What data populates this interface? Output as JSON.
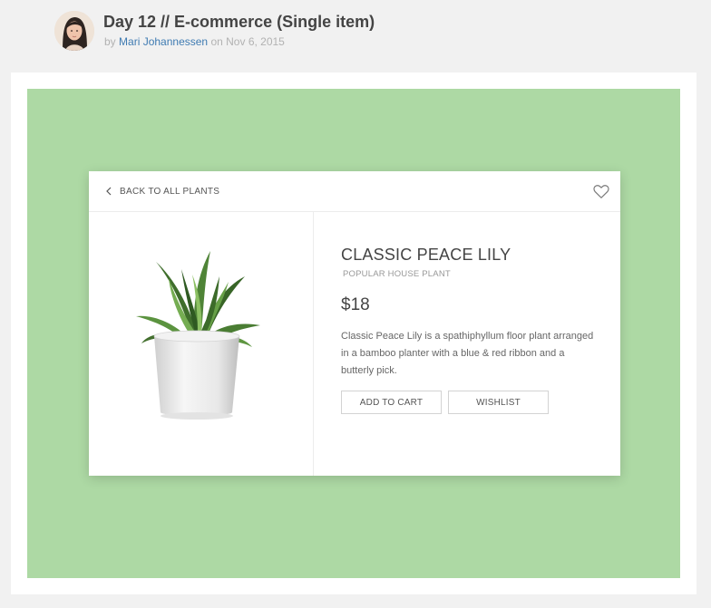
{
  "post": {
    "title": "Day 12 // E-commerce (Single item)",
    "by_prefix": "by",
    "author": "Mari Johannessen",
    "on_text": "on",
    "date": "Nov 6, 2015"
  },
  "product_card": {
    "back_label": "BACK TO ALL PLANTS",
    "name": "CLASSIC PEACE LILY",
    "subtitle": "POPULAR HOUSE PLANT",
    "price": "$18",
    "description": "Classic Peace Lily is a spathiphyllum floor plant arranged in a bamboo planter with a blue & red ribbon and a butterly pick.",
    "add_to_cart_label": "ADD TO CART",
    "wishlist_label": "WISHLIST"
  },
  "colors": {
    "shot_background": "#add9a4",
    "author_link": "#3f7bb2",
    "page_background": "#f1f1f1"
  },
  "icons": [
    "avatar",
    "chevron-left-icon",
    "heart-icon",
    "plant-image"
  ]
}
